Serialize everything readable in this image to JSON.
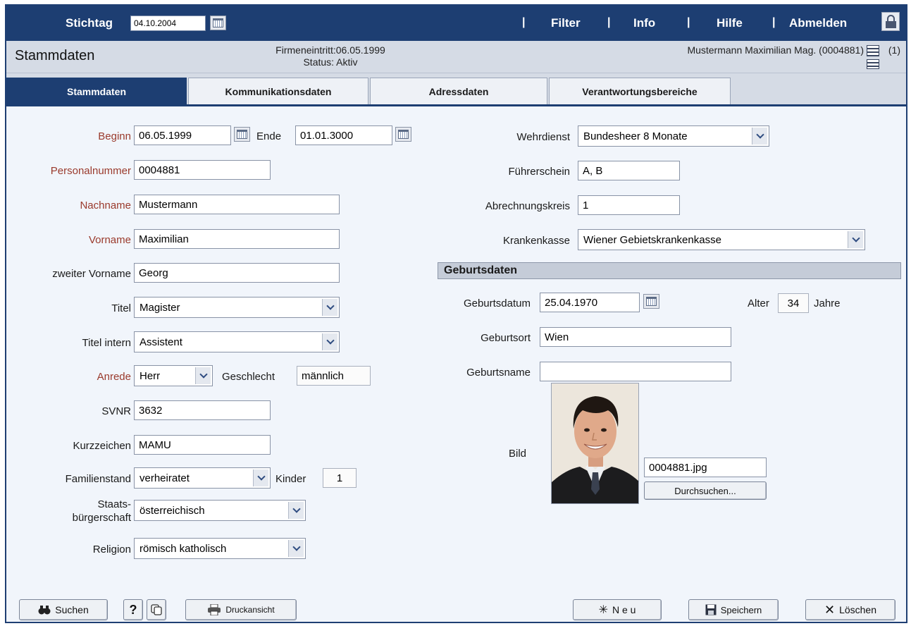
{
  "topbar": {
    "stichtag_label": "Stichtag",
    "stichtag_value": "04.10.2004",
    "sep": "|",
    "filter": "Filter",
    "info": "Info",
    "hilfe": "Hilfe",
    "abmelden": "Abmelden"
  },
  "header": {
    "title": "Stammdaten",
    "eintritt": "Firmeneintritt:06.05.1999",
    "status": "Status: Aktiv",
    "person": "Mustermann Maximilian Mag. (0004881)",
    "count": "(1)"
  },
  "tabs": [
    "Stammdaten",
    "Kommunikationsdaten",
    "Adressdaten",
    "Verantwortungsbereiche"
  ],
  "form": {
    "beginn_label": "Beginn",
    "beginn": "06.05.1999",
    "ende_label": "Ende",
    "ende": "01.01.3000",
    "personalnummer_label": "Personalnummer",
    "personalnummer": "0004881",
    "nachname_label": "Nachname",
    "nachname": "Mustermann",
    "vorname_label": "Vorname",
    "vorname": "Maximilian",
    "zweiter_vorname_label": "zweiter Vorname",
    "zweiter_vorname": "Georg",
    "titel_label": "Titel",
    "titel": "Magister",
    "titel_intern_label": "Titel intern",
    "titel_intern": "Assistent",
    "anrede_label": "Anrede",
    "anrede": "Herr",
    "geschlecht_label": "Geschlecht",
    "geschlecht": "männlich",
    "svnr_label": "SVNR",
    "svnr": "3632",
    "kurzzeichen_label": "Kurzzeichen",
    "kurzzeichen": "MAMU",
    "familienstand_label": "Familienstand",
    "familienstand": "verheiratet",
    "kinder_label": "Kinder",
    "kinder": "1",
    "staats_label_1": "Staats-",
    "staats_label_2": "bürgerschaft",
    "staatsbuergerschaft": "österreichisch",
    "religion_label": "Religion",
    "religion": "römisch katholisch",
    "wehrdienst_label": "Wehrdienst",
    "wehrdienst": "Bundesheer 8 Monate",
    "fuehrerschein_label": "Führerschein",
    "fuehrerschein": "A, B",
    "abrechnungskreis_label": "Abrechnungskreis",
    "abrechnungskreis": "1",
    "krankenkasse_label": "Krankenkasse",
    "krankenkasse": "Wiener Gebietskrankenkasse",
    "section_geburtsdaten": "Geburtsdaten",
    "geburtsdatum_label": "Geburtsdatum",
    "geburtsdatum": "25.04.1970",
    "alter_label": "Alter",
    "alter": "34",
    "jahre_label": "Jahre",
    "geburtsort_label": "Geburtsort",
    "geburtsort": "Wien",
    "geburtsname_label": "Geburtsname",
    "geburtsname": "",
    "bild_label": "Bild",
    "bild_file": "0004881.jpg",
    "durchsuchen": "Durchsuchen..."
  },
  "footer": {
    "suchen": "Suchen",
    "help": "?",
    "druckansicht": "Druckansicht",
    "neu": "N e u",
    "speichern": "Speichern",
    "loeschen": "Löschen"
  }
}
